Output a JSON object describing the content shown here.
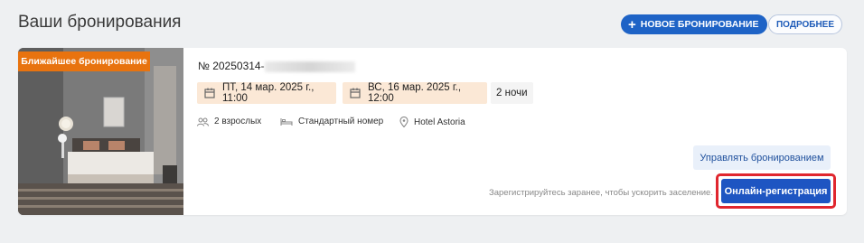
{
  "header": {
    "title": "Ваши бронирования",
    "new_booking_label": "НОВОЕ БРОНИРОВАНИЕ",
    "more_label": "ПОДРОБНЕЕ"
  },
  "booking": {
    "badge": "Ближайшее бронирование",
    "number_prefix": "№ 20250314-",
    "checkin": "ПТ, 14 мар. 2025 г., 11:00",
    "checkout": "ВС, 16 мар. 2025 г., 12:00",
    "nights": "2 ночи",
    "guests": "2 взрослых",
    "room": "Стандартный номер",
    "hotel": "Hotel Astoria",
    "manage_label": "Управлять бронированием",
    "hint": "Зарегистрируйтесь заранее, чтобы ускорить заселение.",
    "checkin_button_label": "Онлайн-регистрация"
  },
  "icons": {
    "plus": "plus-icon",
    "calendar": "calendar-icon",
    "guests": "users-icon",
    "room": "bed-icon",
    "location": "location-pin-icon"
  },
  "colors": {
    "primary": "#1e63c6",
    "badge": "#e8730f",
    "chip": "#fbe8d6",
    "highlight": "#e0262e"
  }
}
